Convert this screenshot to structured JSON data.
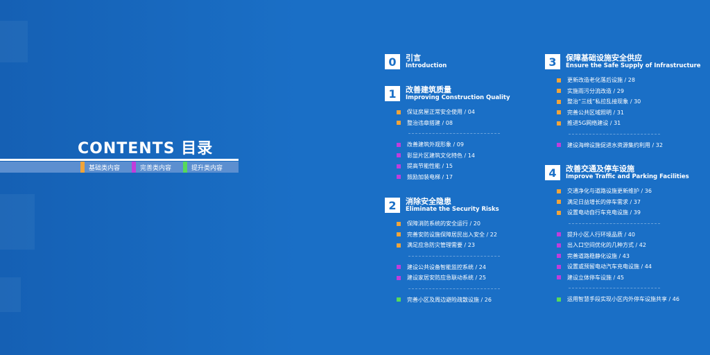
{
  "header": {
    "title": "CONTENTS  目录",
    "legend": [
      {
        "label": "基础类内容",
        "color": "#f0a43a"
      },
      {
        "label": "完善类内容",
        "color": "#c13ddb"
      },
      {
        "label": "提升类内容",
        "color": "#57d95a"
      }
    ]
  },
  "colors": {
    "orange": "#f0a43a",
    "purple": "#c13ddb",
    "green": "#57d95a",
    "background": "#1a6fc6"
  },
  "sections": [
    {
      "num": "0",
      "zh": "引言",
      "en": "Introduction",
      "groups": []
    },
    {
      "num": "1",
      "zh": "改善建筑质量",
      "en": "Improving Construction Quality",
      "groups": [
        {
          "type": "orange",
          "items": [
            "保证房屋正常安全使用 / 04",
            "整治违章搭建 / 08"
          ]
        },
        {
          "type": "purple",
          "items": [
            "改善建筑外观形象 / 09",
            "彰显片区建筑文化特色 / 14",
            "提高节能性能 / 15",
            "鼓励加装电梯 / 17"
          ]
        }
      ]
    },
    {
      "num": "2",
      "zh": "消除安全隐患",
      "en": "Eliminate the Security Risks",
      "groups": [
        {
          "type": "orange",
          "items": [
            "保障消防系统的安全运行 / 20",
            "完善安防设施保障居民出入安全 / 22",
            "满足应急防灾管理需要 / 23"
          ]
        },
        {
          "type": "purple",
          "items": [
            "建设公共设备智能监控系统 / 24",
            "建设家居安防应急联动系统 / 25"
          ]
        },
        {
          "type": "green",
          "items": [
            "完善小区及周边避险疏散设施 / 26"
          ]
        }
      ]
    },
    {
      "num": "3",
      "zh": "保障基础设施安全供应",
      "en": "Ensure the Safe Supply of Infrastructure",
      "groups": [
        {
          "type": "orange",
          "items": [
            "更新改造老化落后设施 / 28",
            "实施雨污分流改造 / 29",
            "整治“三线”私拉乱接现象 / 30",
            "完善公共区域照明 / 31",
            "推进5G网络建设 / 31"
          ]
        },
        {
          "type": "purple",
          "items": [
            "建设海绵设施促进水资源集约利用 / 32"
          ]
        }
      ]
    },
    {
      "num": "4",
      "zh": "改善交通及停车设施",
      "en": "Improve Traffic and Parking Facilities",
      "groups": [
        {
          "type": "orange",
          "items": [
            "交通净化与道路设施更新维护 / 36",
            "满足日益增长的停车需求 / 37",
            "设置电动自行车充电设施 / 39"
          ]
        },
        {
          "type": "purple",
          "items": [
            "提升小区人行环境品质 / 40",
            "出入口空间优化的几种方式 / 42",
            "完善道路稳静化设施 / 43",
            "设置或预留电动汽车充电设施 / 44",
            "建设立体停车设施 / 45"
          ]
        },
        {
          "type": "green",
          "items": [
            "运用智慧手段实现小区内外停车设施共享 / 46"
          ]
        }
      ]
    }
  ]
}
